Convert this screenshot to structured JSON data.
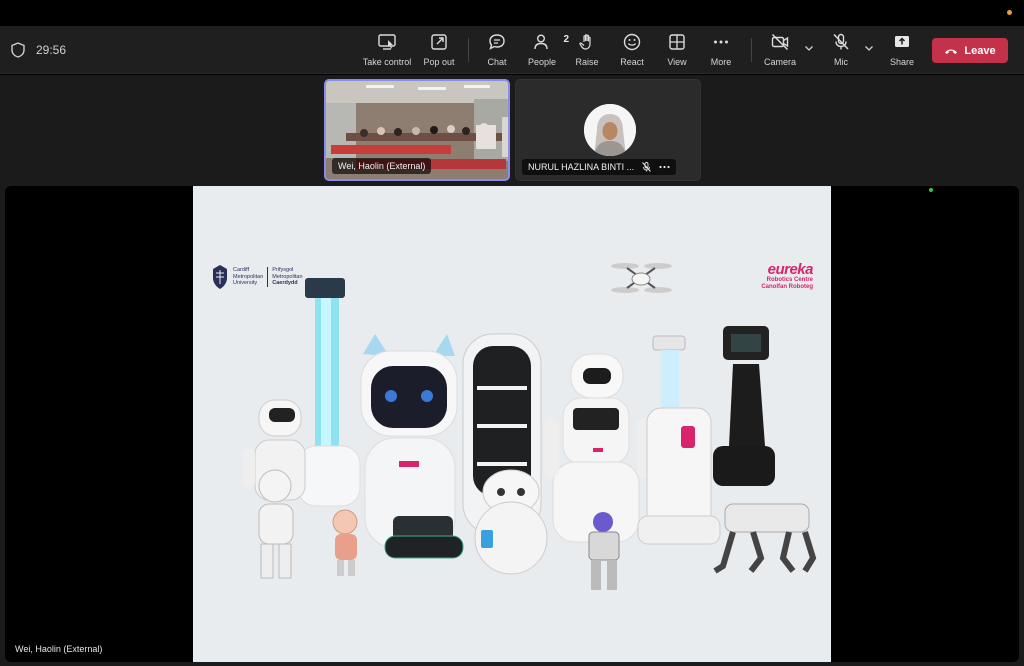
{
  "meeting": {
    "timer": "29:56"
  },
  "toolbar": {
    "take_control": "Take control",
    "pop_out": "Pop out",
    "chat": "Chat",
    "people": "People",
    "people_count": "2",
    "raise": "Raise",
    "react": "React",
    "view": "View",
    "more": "More",
    "camera": "Camera",
    "mic": "Mic",
    "share": "Share",
    "leave": "Leave"
  },
  "participants": [
    {
      "name": "Wei, Haolin (External)"
    },
    {
      "name": "NURUL HAZLINA BINTI ..."
    }
  ],
  "screen_share": {
    "presenter": "Wei, Haolin (External)",
    "slide": {
      "left_logo": {
        "line1": "Cardiff",
        "line2": "Metropolitan",
        "line3": "University",
        "welsh1": "Prifysgol",
        "welsh2": "Metropolitan",
        "welsh3": "Caerdydd"
      },
      "right_logo": {
        "brand": "eureka",
        "line1": "Robotics Centre",
        "line2": "Canolfan Roboteg"
      }
    }
  },
  "colors": {
    "toolbar_bg": "#1f1f1f",
    "leave": "#c4314b",
    "active_tile_border": "#8b8cf0",
    "brand_pink": "#d8246b"
  }
}
